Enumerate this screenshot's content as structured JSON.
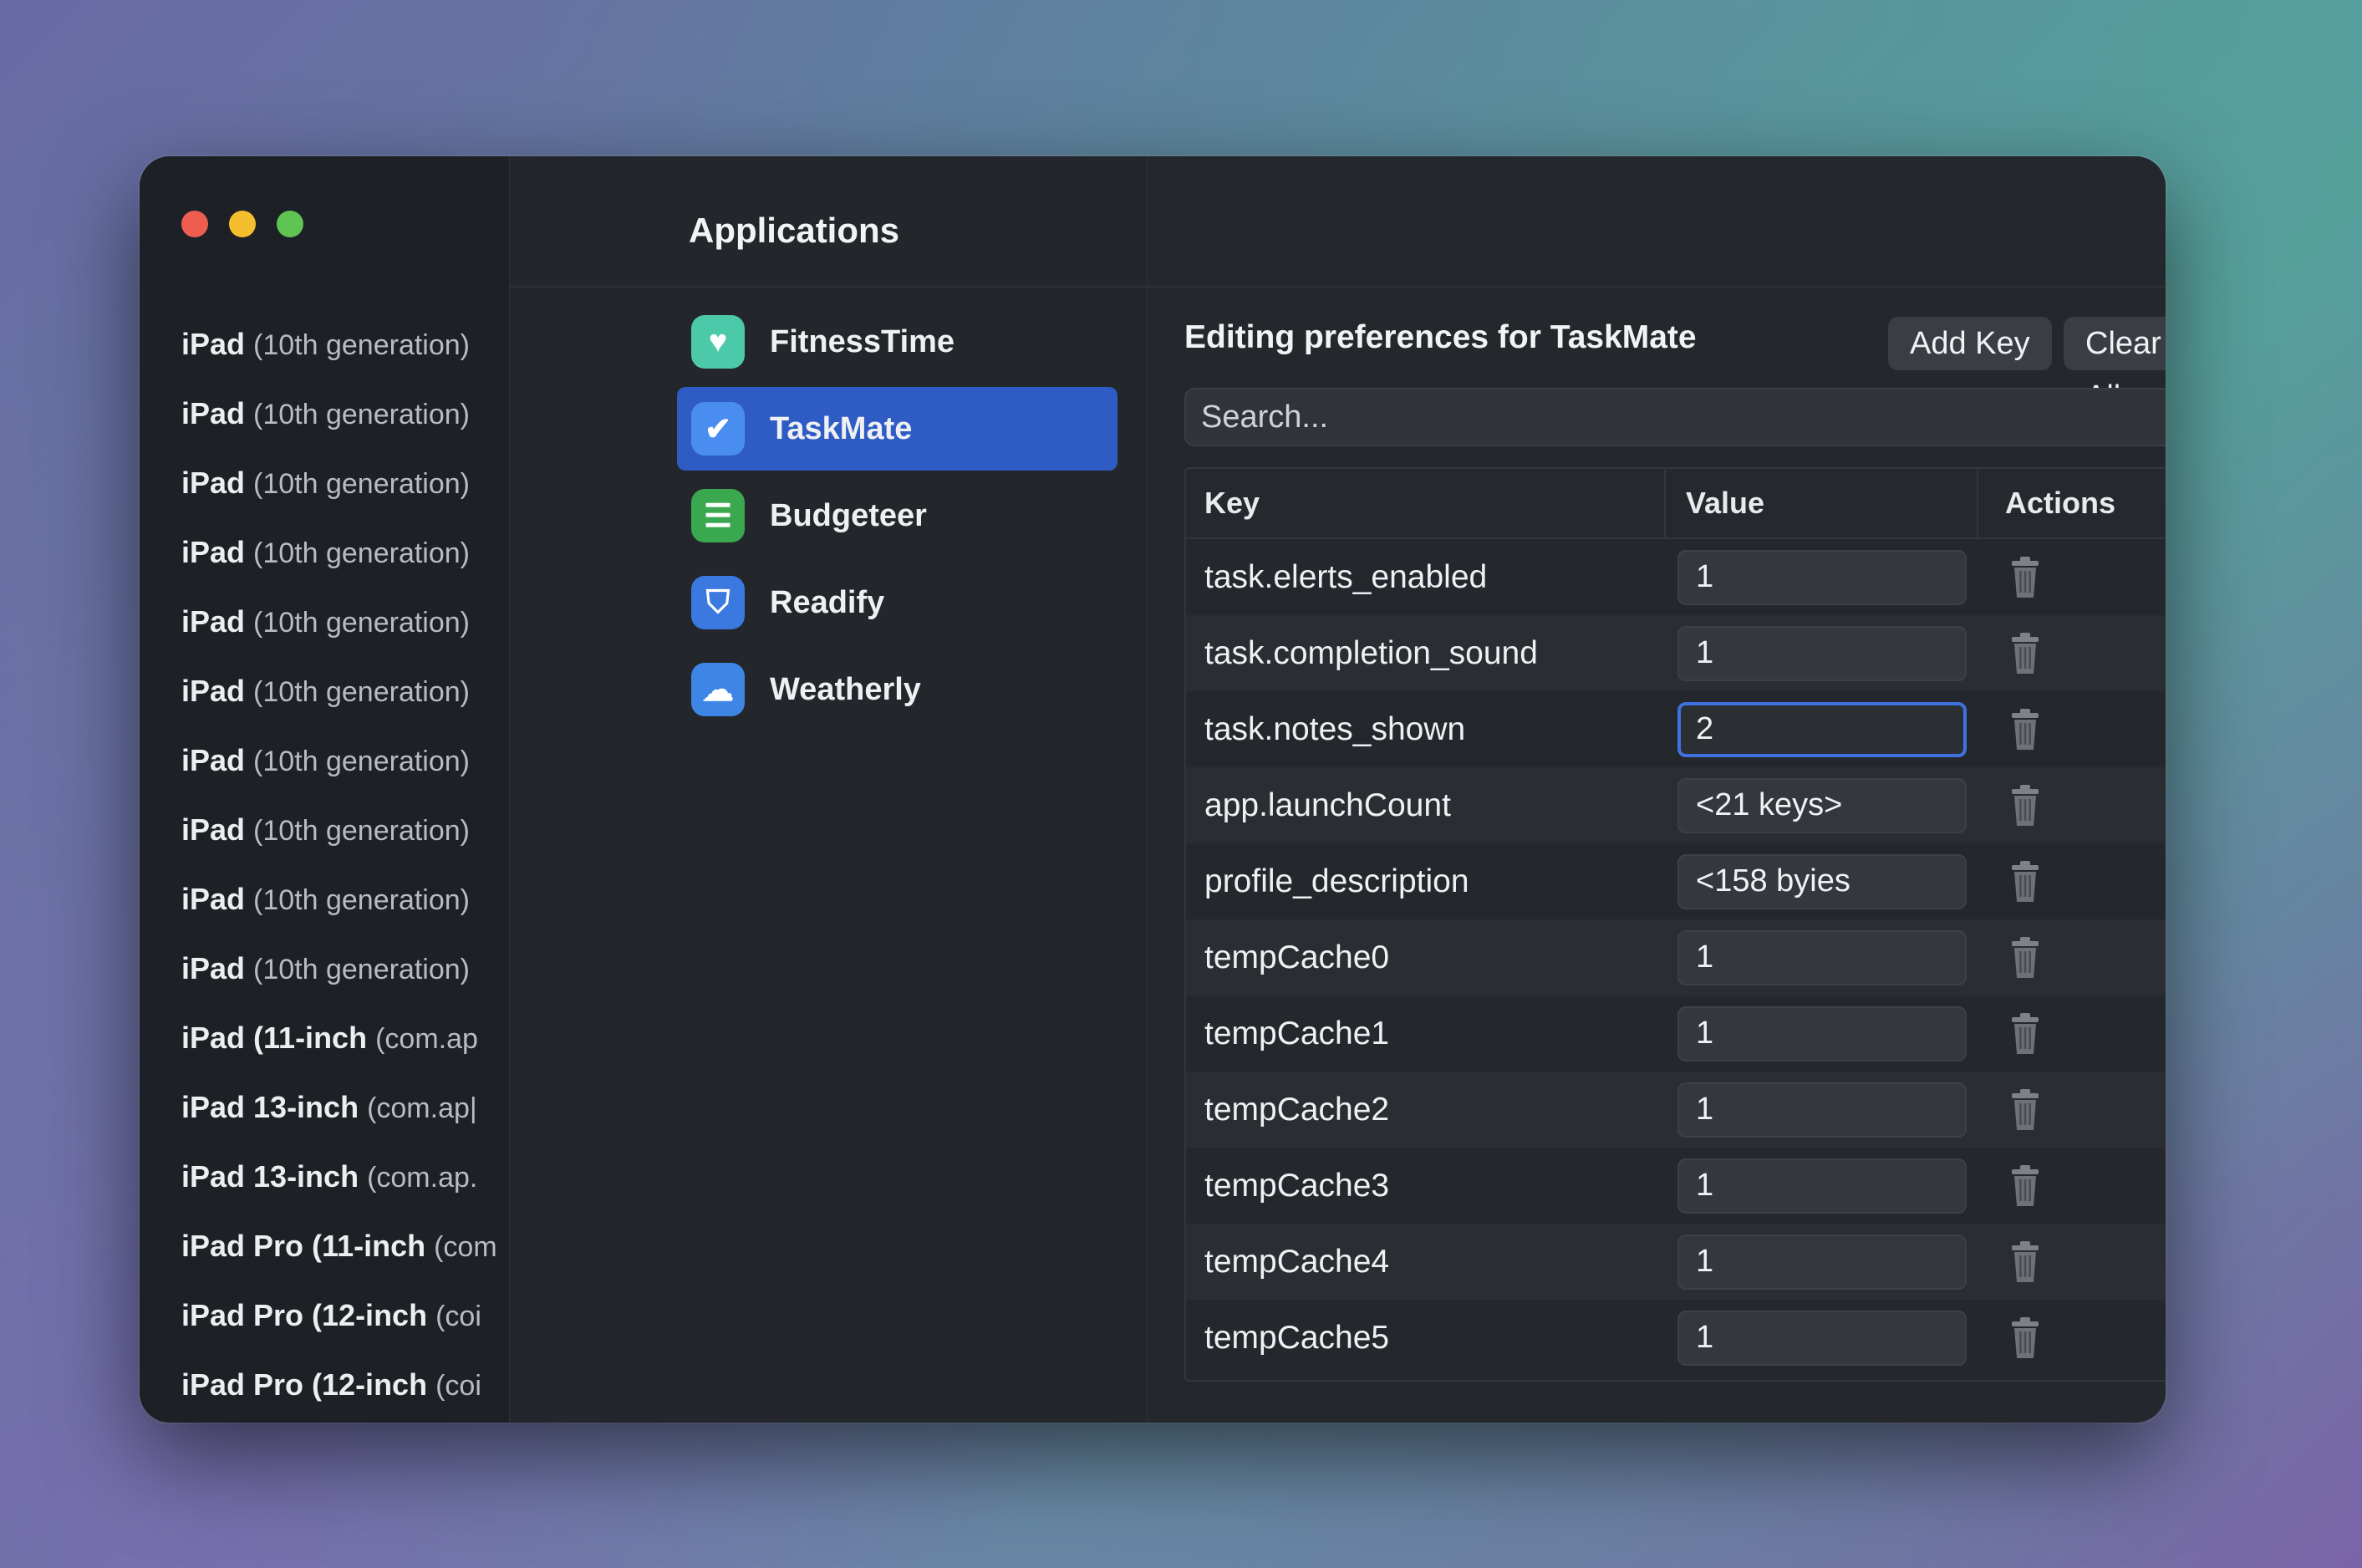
{
  "devices": [
    {
      "name": "iPad",
      "detail": "(10th generation)"
    },
    {
      "name": "iPad",
      "detail": "(10th generation)"
    },
    {
      "name": "iPad",
      "detail": "(10th generation)"
    },
    {
      "name": "iPad",
      "detail": "(10th generation)"
    },
    {
      "name": "iPad",
      "detail": "(10th generation)"
    },
    {
      "name": "iPad",
      "detail": "(10th generation)"
    },
    {
      "name": "iPad",
      "detail": "(10th generation)"
    },
    {
      "name": "iPad",
      "detail": "(10th generation)"
    },
    {
      "name": "iPad",
      "detail": "(10th generation)"
    },
    {
      "name": "iPad",
      "detail": "(10th generation)"
    },
    {
      "name": "iPad (11-inch",
      "detail": "(com.ap"
    },
    {
      "name": "iPad 13-inch",
      "detail": "(com.ap|"
    },
    {
      "name": "iPad 13-inch",
      "detail": "(com.ap."
    },
    {
      "name": "iPad Pro (11-inch",
      "detail": "(com"
    },
    {
      "name": "iPad Pro (12-inch",
      "detail": "(coi"
    },
    {
      "name": "iPad Pro (12-inch",
      "detail": "(coi"
    }
  ],
  "apps": {
    "title": "Applications",
    "items": [
      {
        "label": "FitnessTime",
        "icon": "heart-icon",
        "color": "#4cc9a8",
        "glyph": "♥",
        "selected": false
      },
      {
        "label": "TaskMate",
        "icon": "checkmark-icon",
        "color": "#4a8df0",
        "glyph": "✔",
        "selected": true
      },
      {
        "label": "Budgeteer",
        "icon": "list-icon",
        "color": "#3aa84f",
        "glyph": "☰",
        "selected": false
      },
      {
        "label": "Readify",
        "icon": "shield-icon",
        "color": "#3b78e0",
        "glyph": "⛉",
        "selected": false
      },
      {
        "label": "Weatherly",
        "icon": "sun-cloud-icon",
        "color": "#3d86e6",
        "glyph": "☁",
        "selected": false
      }
    ]
  },
  "editor": {
    "title": "Editing preferences for TaskMate",
    "add_key_label": "Add Key",
    "clear_all_label": "Clear All",
    "search_placeholder": "Search...",
    "columns": {
      "key": "Key",
      "value": "Value",
      "actions": "Actions"
    },
    "rows": [
      {
        "key": "task.elerts_enabled",
        "value": "1"
      },
      {
        "key": "task.completion_sound",
        "value": "1"
      },
      {
        "key": "task.notes_shown",
        "value": "2",
        "focused": true
      },
      {
        "key": "app.launchCount",
        "value": "<21 keys>"
      },
      {
        "key": "profile_description",
        "value": "<158 byies"
      },
      {
        "key": "tempCache0",
        "value": "1"
      },
      {
        "key": "tempCache1",
        "value": "1"
      },
      {
        "key": "tempCache2",
        "value": "1"
      },
      {
        "key": "tempCache3",
        "value": "1"
      },
      {
        "key": "tempCache4",
        "value": "1"
      },
      {
        "key": "tempCache5",
        "value": "1"
      }
    ]
  },
  "colors": {
    "accent": "#2e5cc4",
    "focus": "#3f72e0",
    "close": "#ee5d50",
    "minimize": "#f5be2f",
    "zoom": "#5ec553"
  }
}
